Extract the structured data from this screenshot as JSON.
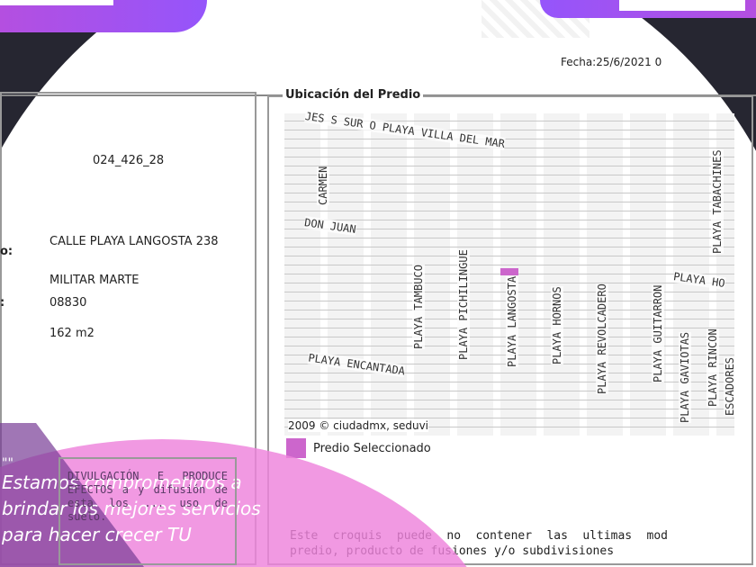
{
  "header": {
    "fecha": "Fecha:25/6/2021 0"
  },
  "info": {
    "cuenta": "024_426_28",
    "direccion_label": "o:",
    "direccion": "CALLE PLAYA LANGOSTA 238",
    "colonia": "MILITAR MARTE",
    "cp_label": ":",
    "cp": "08830",
    "superficie": "162 m2"
  },
  "divulgacion": "DIVULGACIÓN E PRODUCE EFECTOS a y difusión de esta los ... uso de suelo.",
  "map": {
    "title": "Ubicación del Predio",
    "copyright": "2009 © ciudadmx, seduvi",
    "legend": "Predio Seleccionado",
    "streets": [
      "JES S SUR O PLAYA VILLA DEL MAR",
      "CARMEN",
      "DON JUAN",
      "PLAYA TAMBUCO",
      "PLAYA PICHILINGUE",
      "PLAYA LANGOSTA",
      "PLAYA HORNOS",
      "PLAYA REVOLCADERO",
      "PLAYA GUITARRON",
      "PLAYA HO",
      "PLAYA TABACHINES",
      "PLAYA ENCANTADA",
      "PLAYA GAVIOTAS",
      "PLAYA RINCON",
      "ESCADORES"
    ],
    "selected_color": "#cc66cc"
  },
  "note": "Este croquis puede no contener las ultimas mod predio, producto de fusiones y/o subdivisiones",
  "promo": {
    "quote_mark": "\"\"",
    "line1": "Estamos comprometidos a",
    "line2": "brindar los mejores servicios",
    "line3": "para hacer crecer TU"
  }
}
